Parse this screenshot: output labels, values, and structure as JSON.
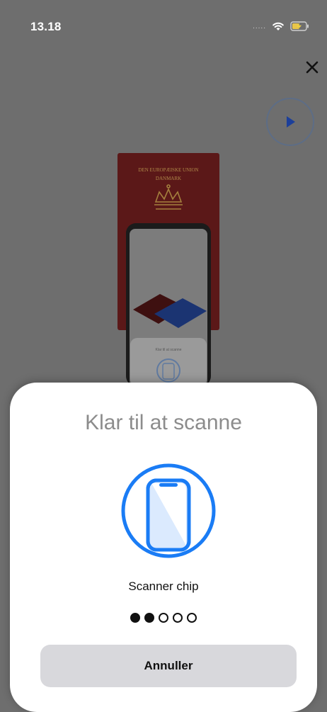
{
  "status_bar": {
    "time": "13.18",
    "signal": "....."
  },
  "illustration": {
    "passport_line1": "DEN EUROPÆISKE UNION",
    "passport_line2": "DANMARK",
    "mini_sheet_title": "Klar til at scanne"
  },
  "sheet": {
    "title": "Klar til at scanne",
    "status": "Scanner chip",
    "progress": {
      "total": 5,
      "filled": 2
    },
    "cancel_label": "Annuller"
  },
  "colors": {
    "accent": "#1a7cf5",
    "sheet_bg": "#ffffff",
    "overlay": "#6e6e6e",
    "passport": "#5b1818"
  }
}
